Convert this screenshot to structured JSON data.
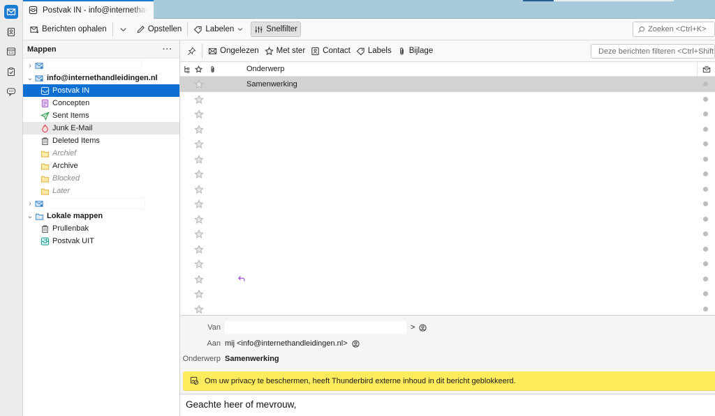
{
  "spaces": [
    {
      "name": "mail",
      "icon": "mail-icon",
      "active": true
    },
    {
      "name": "address-book",
      "icon": "address-book-icon",
      "active": false
    },
    {
      "name": "calendar",
      "icon": "calendar-icon",
      "active": false
    },
    {
      "name": "tasks",
      "icon": "tasks-icon",
      "active": false
    },
    {
      "name": "chat",
      "icon": "chat-icon",
      "active": false
    }
  ],
  "tab": {
    "label": "Postvak IN - info@internethandleidingen.nl"
  },
  "toolbar": {
    "get_messages": "Berichten ophalen",
    "compose": "Opstellen",
    "tag": "Labelen",
    "quick_filter": "Snelfilter",
    "search_placeholder": "Zoeken <Ctrl+K>"
  },
  "folder_pane": {
    "title": "Mappen",
    "more": "···",
    "account_name": "info@internethandleidingen.nl",
    "folders": [
      {
        "label": "Postvak IN",
        "icon": "inbox-icon"
      },
      {
        "label": "Concepten",
        "icon": "drafts-icon"
      },
      {
        "label": "Sent Items",
        "icon": "sent-icon"
      },
      {
        "label": "Junk E-Mail",
        "icon": "junk-icon"
      },
      {
        "label": "Deleted Items",
        "icon": "trash-icon"
      },
      {
        "label": "Archief",
        "icon": "folder-icon"
      },
      {
        "label": "Archive",
        "icon": "folder-icon"
      },
      {
        "label": "Blocked",
        "icon": "folder-icon"
      },
      {
        "label": "Later",
        "icon": "folder-icon"
      }
    ],
    "local_account": "Lokale mappen",
    "local_folders": [
      {
        "label": "Prullenbak",
        "icon": "trash-icon"
      },
      {
        "label": "Postvak UIT",
        "icon": "outbox-icon"
      }
    ]
  },
  "quick_filter": {
    "unread": "Ongelezen",
    "starred": "Met ster",
    "contact": "Contact",
    "tags": "Labels",
    "attachment": "Bijlage",
    "filter_placeholder": "Deze berichten filteren <Ctrl+Shift+K>"
  },
  "thread_pane": {
    "columns": {
      "subject": "Onderwerp"
    },
    "rows": [
      {
        "subject": "Samenwerking",
        "selected": true
      },
      {
        "subject": ""
      },
      {
        "subject": ""
      },
      {
        "subject": ""
      },
      {
        "subject": ""
      },
      {
        "subject": ""
      },
      {
        "subject": ""
      },
      {
        "subject": ""
      },
      {
        "subject": ""
      },
      {
        "subject": ""
      },
      {
        "subject": ""
      },
      {
        "subject": ""
      },
      {
        "subject": ""
      },
      {
        "subject": "",
        "replied": true
      },
      {
        "subject": ""
      },
      {
        "subject": ""
      }
    ]
  },
  "message": {
    "from_label": "Van",
    "from_suffix": ">",
    "to_label": "Aan",
    "to_value": "mij <info@internethandleidingen.nl>",
    "subject_label": "Onderwerp",
    "subject_value": "Samenwerking",
    "remote_content_notice": "Om uw privacy te beschermen, heeft Thunderbird externe inhoud in dit bericht geblokkeerd.",
    "body_greeting": "Geachte heer of mevrouw,"
  },
  "colors": {
    "accent": "#0b6fd4",
    "titlebar": "#a8cadb",
    "notice": "#ffec5c",
    "selected_row": "#d2d2d2"
  }
}
